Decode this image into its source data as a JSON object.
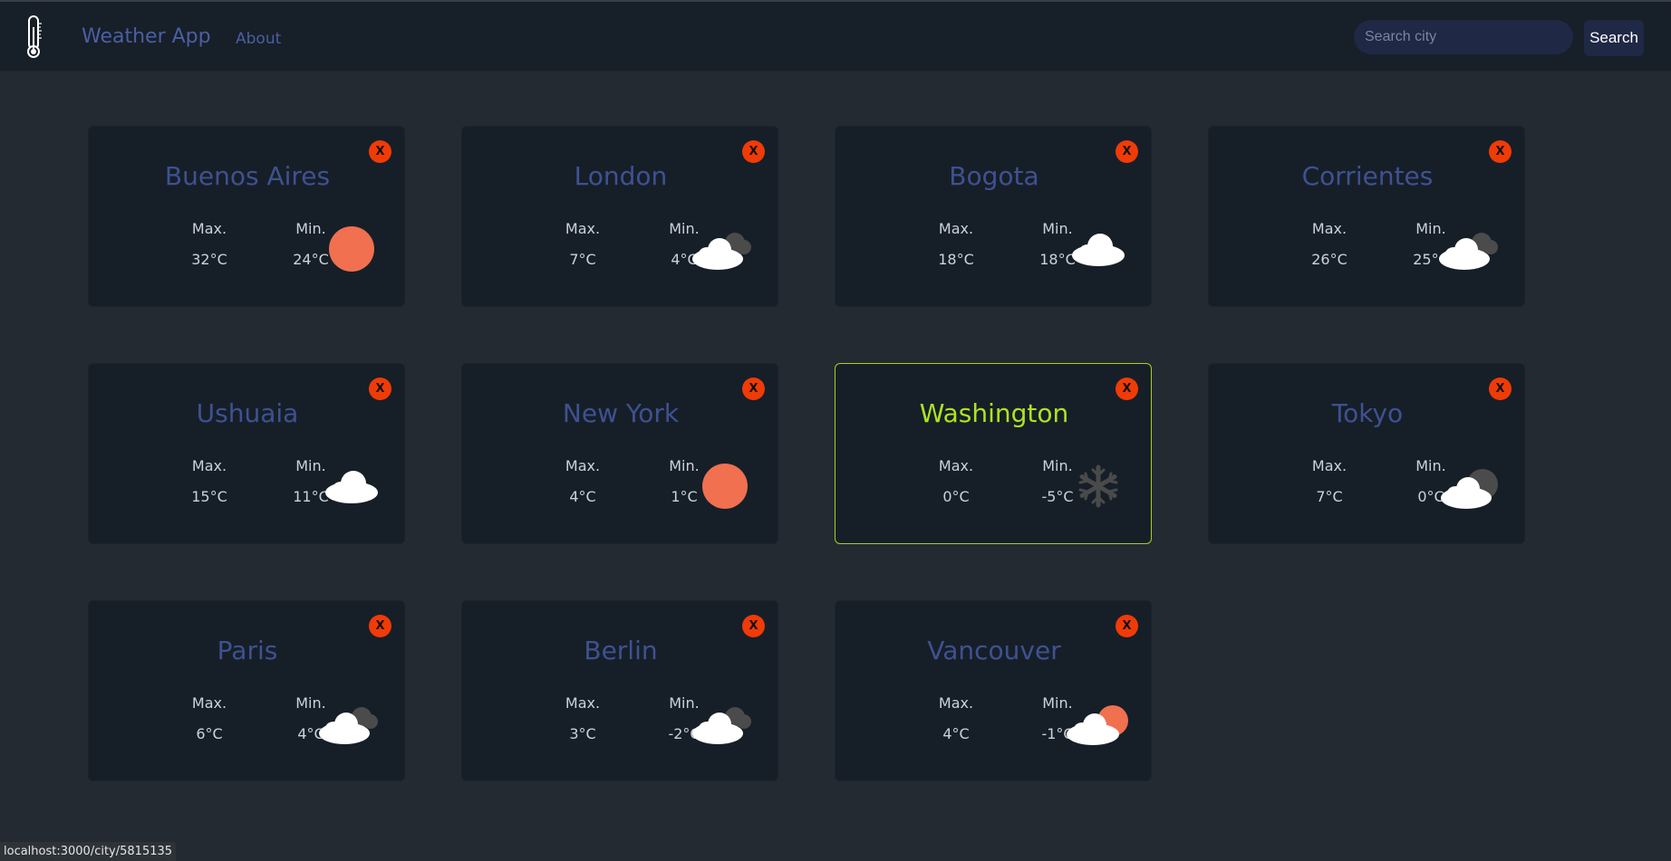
{
  "app": {
    "title": "Weather App",
    "about_label": "About"
  },
  "search": {
    "placeholder": "Search city",
    "value": "",
    "button_label": "Search"
  },
  "labels": {
    "max": "Max.",
    "min": "Min.",
    "close": "X"
  },
  "cards": [
    {
      "name": "Buenos Aires",
      "max": "32°C",
      "min": "24°C",
      "icon": "sun-icon"
    },
    {
      "name": "London",
      "max": "7°C",
      "min": "4°C",
      "icon": "clouds-icon"
    },
    {
      "name": "Bogota",
      "max": "18°C",
      "min": "18°C",
      "icon": "cloud-icon"
    },
    {
      "name": "Corrientes",
      "max": "26°C",
      "min": "25°C",
      "icon": "clouds-icon"
    },
    {
      "name": "Ushuaia",
      "max": "15°C",
      "min": "11°C",
      "icon": "cloud-icon"
    },
    {
      "name": "New York",
      "max": "4°C",
      "min": "1°C",
      "icon": "sun-icon"
    },
    {
      "name": "Washington",
      "max": "0°C",
      "min": "-5°C",
      "icon": "snowflake-icon",
      "highlighted": true
    },
    {
      "name": "Tokyo",
      "max": "7°C",
      "min": "0°C",
      "icon": "cloud-dark-icon"
    },
    {
      "name": "Paris",
      "max": "6°C",
      "min": "4°C",
      "icon": "clouds-icon"
    },
    {
      "name": "Berlin",
      "max": "3°C",
      "min": "-2°C",
      "icon": "clouds-icon"
    },
    {
      "name": "Vancouver",
      "max": "4°C",
      "min": "-1°C",
      "icon": "cloud-sun-icon"
    }
  ],
  "colors": {
    "accent": "#aee321",
    "city_name": "#3f5190",
    "close_button": "#f03b07",
    "sun": "#f07050"
  },
  "status_url": "localhost:3000/city/5815135"
}
